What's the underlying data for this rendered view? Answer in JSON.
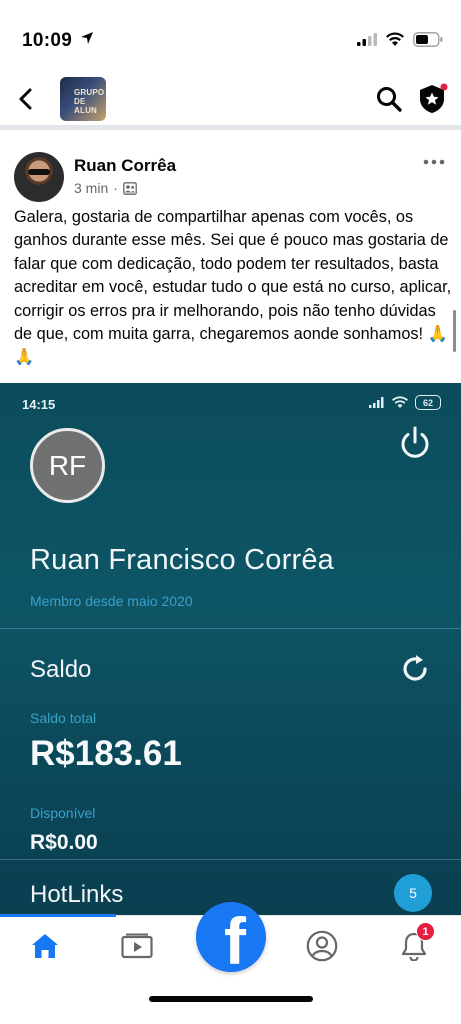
{
  "status_bar": {
    "time": "10:09"
  },
  "header": {
    "group_thumb_text_line1": "GRUPO",
    "group_thumb_text_line2": "DE ALUN"
  },
  "post": {
    "author": "Ruan Corrêa",
    "time": "3 min",
    "separator": "·",
    "text": "Galera, gostaria de compartilhar apenas com vocês, os ganhos durante esse mês. Sei que é pouco mas gostaria de falar que com dedicação, todo podem ter resultados, basta acreditar em você, estudar tudo o que está no curso, aplicar, corrigir os erros pra ir melhorando, pois não tenho dúvidas de que, com muita garra, chegaremos aonde sonhamos! 🙏🙏"
  },
  "embedded_app": {
    "status_time": "14:15",
    "battery": "62",
    "avatar_initials": "RF",
    "full_name": "Ruan Francisco Corrêa",
    "member_since": "Membro desde maio 2020",
    "balance_title": "Saldo",
    "total_label": "Saldo total",
    "total_value": "R$183.61",
    "available_label": "Disponível",
    "available_value": "R$0.00",
    "hotlinks_title": "HotLinks",
    "hotlinks_count": "5"
  },
  "bottom_nav": {
    "fab_letter": "f",
    "notification_count": "1",
    "active_color": "#1877f2"
  },
  "colors": {
    "facebook_blue": "#1877f2",
    "embed_bg": "#0d5566",
    "embed_accent": "#3aa0c8",
    "badge_red": "#e41e3f"
  }
}
